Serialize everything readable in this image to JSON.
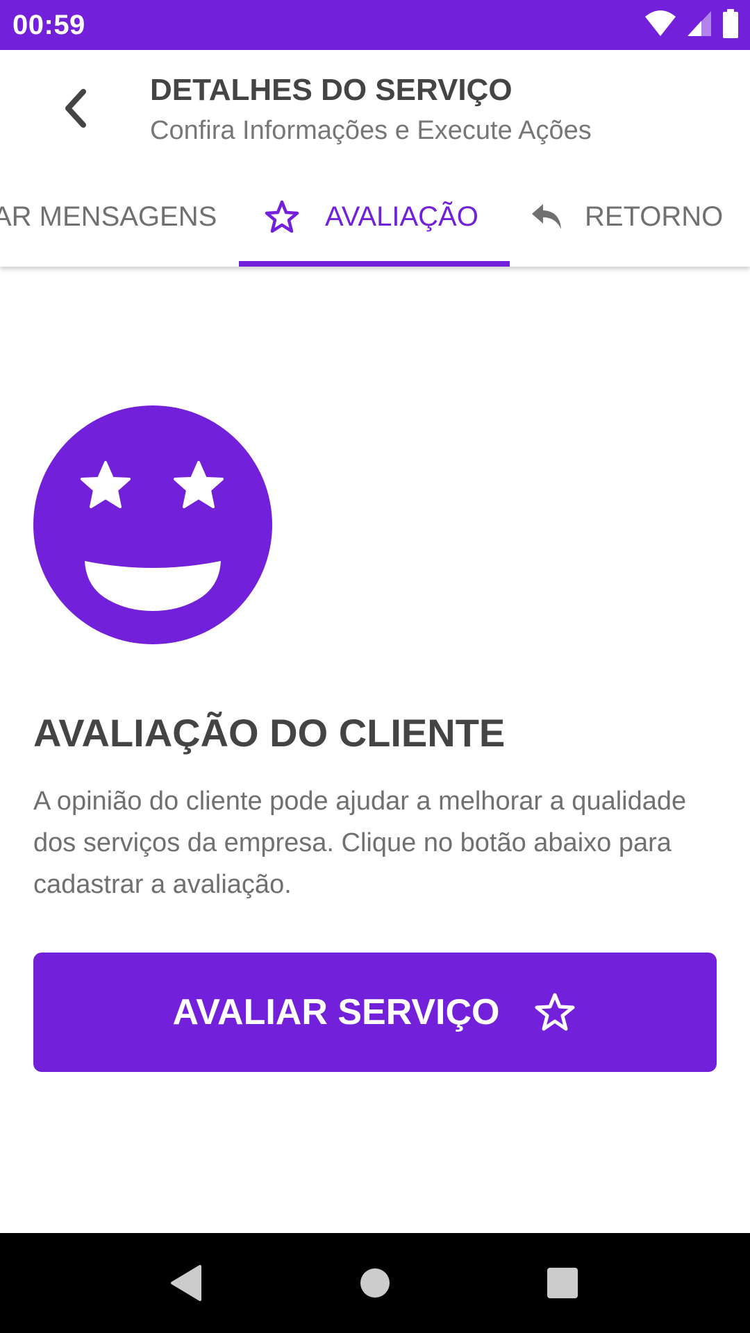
{
  "status_bar": {
    "time": "00:59",
    "icons": [
      "wifi-icon",
      "signal-icon",
      "battery-icon"
    ]
  },
  "app_bar": {
    "back_icon": "chevron-left-icon",
    "title": "DETALHES DO SERVIÇO",
    "subtitle": "Confira Informações e Execute Ações"
  },
  "tabs": [
    {
      "label": "AR MENSAGENS",
      "icon": "",
      "selected": false
    },
    {
      "label": "AVALIAÇÃO",
      "icon": "star-outline-icon",
      "selected": true
    },
    {
      "label": "RETORNO",
      "icon": "reply-icon",
      "selected": false
    }
  ],
  "content": {
    "illustration": "star-struck-emoji-icon",
    "title": "AVALIAÇÃO DO CLIENTE",
    "description": "A opinião do cliente pode ajudar a melhorar a qualidade dos serviços da empresa. Clique no botão abaixo para cadastrar a avaliação.",
    "button_label": "AVALIAR SERVIÇO",
    "button_icon": "star-outline-icon"
  },
  "nav_bar": {
    "icons": [
      "nav-back-icon",
      "nav-home-icon",
      "nav-recents-icon"
    ]
  },
  "colors": {
    "primary": "#7320da",
    "title_text": "#444444",
    "body_text": "#707070",
    "nav_bar": "#000000"
  }
}
